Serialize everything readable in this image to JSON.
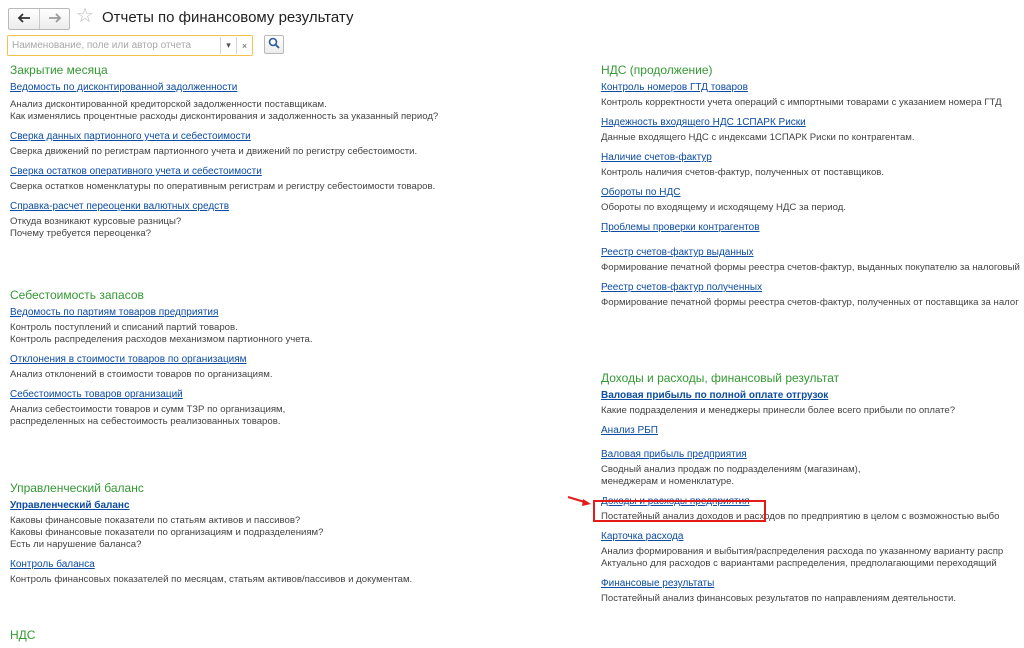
{
  "header": {
    "back_icon": "arrow-left-icon",
    "forward_icon": "arrow-right-icon",
    "favorite_icon": "star-icon",
    "title": "Отчеты по финансовому результату",
    "search": {
      "placeholder": "Наименование, поле или автор отчета",
      "dropdown_glyph": "▾",
      "clear_glyph": "×",
      "go_icon": "search-icon"
    }
  },
  "left_column": {
    "sections": [
      {
        "title": "Закрытие месяца",
        "items": [
          {
            "link": "Ведомость по дисконтированной задолженности",
            "desc": [
              "Анализ дисконтированной кредиторской задолженности поставщикам.",
              "Как изменялись процентные расходы дисконтирования и задолженность за указанный период?"
            ]
          },
          {
            "link": "Сверка данных партионного учета и себестоимости",
            "desc": [
              "Сверка движений по регистрам партионного учета и движений по регистру себестоимости."
            ]
          },
          {
            "link": "Сверка остатков оперативного учета и себестоимости",
            "desc": [
              "Сверка остатков номенклатуры по оперативным регистрам и регистру себестоимости товаров."
            ]
          },
          {
            "link": "Справка-расчет переоценки валютных средств",
            "desc": [
              "Откуда возникают курсовые разницы?",
              "Почему требуется переоценка?"
            ]
          }
        ]
      },
      {
        "title": "Себестоимость запасов",
        "items": [
          {
            "link": "Ведомость по партиям товаров предприятия",
            "desc": [
              "Контроль поступлений и списаний партий товаров.",
              "Контроль распределения расходов механизмом партионного учета."
            ]
          },
          {
            "link": "Отклонения в стоимости товаров по организациям",
            "desc": [
              "Анализ отклонений в стоимости товаров по организациям."
            ]
          },
          {
            "link": "Себестоимость товаров организаций",
            "desc": [
              "Анализ себестоимости товаров и сумм ТЗР по организациям,",
              "распределенных на себестоимость реализованных товаров."
            ]
          }
        ]
      },
      {
        "title": "Управленческий баланс",
        "items": [
          {
            "link": "Управленческий баланс",
            "bold": true,
            "desc": [
              "Каковы финансовые показатели по статьям активов и пассивов?",
              "Каковы финансовые показатели по организациям и подразделениям?",
              "Есть ли нарушение баланса?"
            ]
          },
          {
            "link": "Контроль баланса",
            "desc": [
              "Контроль финансовых показателей по месяцам, статьям активов/пассивов и документам."
            ]
          }
        ]
      },
      {
        "title": "НДС",
        "items": []
      }
    ]
  },
  "right_column": {
    "sections": [
      {
        "title": "НДС (продолжение)",
        "items": [
          {
            "link": "Контроль номеров ГТД товаров",
            "desc": [
              "Контроль корректности учета операций с импортными товарами с указанием номера ГТД"
            ]
          },
          {
            "link": "Надежность входящего НДС 1СПАРК Риски",
            "desc": [
              "Данные входящего НДС с индексами 1СПАРК Риски по контрагентам."
            ]
          },
          {
            "link": "Наличие счетов-фактур",
            "desc": [
              "Контроль наличия счетов-фактур, полученных от поставщиков."
            ]
          },
          {
            "link": "Обороты по НДС",
            "desc": [
              "Обороты по входящему и исходящему НДС за период."
            ]
          },
          {
            "link": "Проблемы проверки контрагентов",
            "desc": []
          },
          {
            "link": "Реестр счетов-фактур выданных",
            "desc": [
              "Формирование печатной формы реестра счетов-фактур, выданных покупателю за налоговый"
            ]
          },
          {
            "link": "Реестр счетов-фактур полученных",
            "desc": [
              "Формирование печатной формы реестра счетов-фактур, полученных от поставщика за налог"
            ]
          }
        ]
      },
      {
        "title": "Доходы и расходы, финансовый результат",
        "items": [
          {
            "link": "Валовая прибыль по полной оплате отгрузок",
            "bold": true,
            "desc": [
              "Какие подразделения и менеджеры принесли более всего прибыли по оплате?"
            ]
          },
          {
            "link": "Анализ РБП",
            "desc": []
          },
          {
            "link": "Валовая прибыль предприятия",
            "desc": [
              "Сводный анализ продаж по подразделениям (магазинам),",
              "менеджерам и номенклатуре."
            ]
          },
          {
            "link": "Доходы и расходы предприятия",
            "desc": [
              "Постатейный анализ доходов и расходов по предприятию в целом с возможностью выбо"
            ]
          },
          {
            "link": "Карточка расхода",
            "desc": [
              "Анализ формирования и выбытия/распределения расхода по указанному варианту распр",
              "Актуально для расходов с вариантами распределения, предполагающими переходящий"
            ]
          },
          {
            "link": "Финансовые результаты",
            "desc": [
              "Постатейный анализ финансовых результатов по направлениям деятельности."
            ]
          }
        ]
      }
    ]
  },
  "annotation": {
    "highlight_color": "#e31b1b",
    "highlighted_report": "Доходы и расходы предприятия"
  }
}
